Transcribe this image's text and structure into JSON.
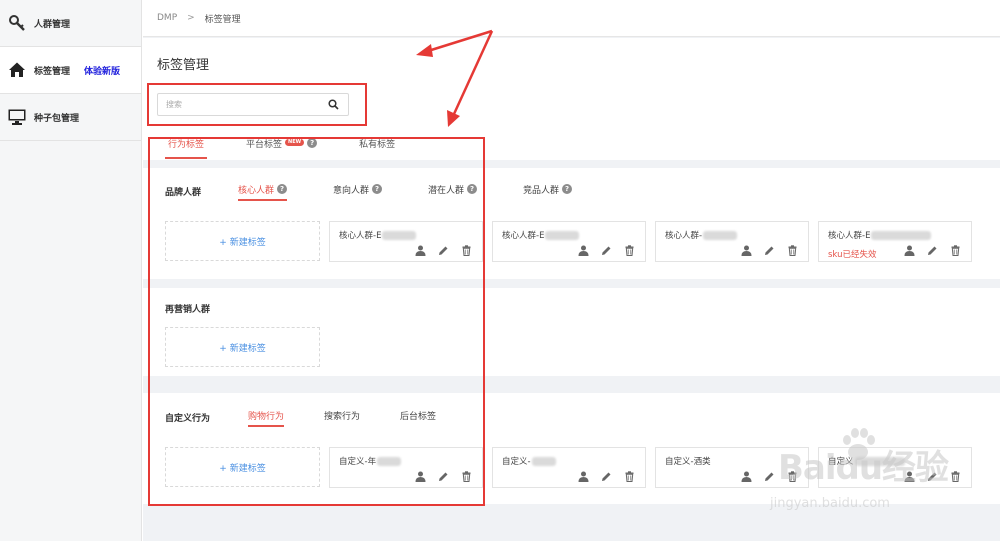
{
  "sidebar": {
    "items": [
      {
        "label": "人群管理",
        "icon": "key-icon",
        "active": false,
        "badge": ""
      },
      {
        "label": "标签管理",
        "icon": "home-icon",
        "active": true,
        "badge": "体验新版"
      },
      {
        "label": "种子包管理",
        "icon": "monitor-icon",
        "active": false,
        "badge": ""
      }
    ]
  },
  "breadcrumb": {
    "root": "DMP",
    "separator": ">",
    "current": "标签管理"
  },
  "page": {
    "title": "标签管理"
  },
  "search": {
    "placeholder": "搜索",
    "value": ""
  },
  "tabs": [
    {
      "label": "行为标签",
      "active": true,
      "badge": ""
    },
    {
      "label": "平台标签",
      "active": false,
      "badge": "NEW"
    },
    {
      "label": "私有标签",
      "active": false,
      "badge": ""
    }
  ],
  "brand_section": {
    "title": "品牌人群",
    "subtabs": [
      {
        "label": "核心人群",
        "active": true
      },
      {
        "label": "意向人群",
        "active": false
      },
      {
        "label": "潜在人群",
        "active": false
      },
      {
        "label": "竞品人群",
        "active": false
      }
    ],
    "new_label": "+ 新建标签",
    "cards": [
      {
        "name": "核心人群-E",
        "status": ""
      },
      {
        "name": "核心人群-E",
        "status": ""
      },
      {
        "name": "核心人群-",
        "status": ""
      },
      {
        "name": "核心人群-E",
        "status": "sku已经失效"
      }
    ]
  },
  "remarketing_section": {
    "title": "再营销人群",
    "new_label": "+ 新建标签"
  },
  "custom_section": {
    "title": "自定义行为",
    "subtabs": [
      {
        "label": "购物行为",
        "active": true
      },
      {
        "label": "搜索行为",
        "active": false
      },
      {
        "label": "后台标签",
        "active": false
      }
    ],
    "new_label": "+ 新建标签",
    "cards": [
      {
        "name": "自定义-年",
        "status": ""
      },
      {
        "name": "自定义-",
        "status": ""
      },
      {
        "name": "自定义-酒类",
        "status": ""
      },
      {
        "name": "自定义",
        "status": ""
      }
    ]
  },
  "colors": {
    "accent": "#e5544b",
    "link": "#4a90e2",
    "annotation": "#e53935",
    "badge": "#2222dd"
  },
  "watermark": {
    "brand": "Baidu经验",
    "url": "jingyan.baidu.com"
  }
}
